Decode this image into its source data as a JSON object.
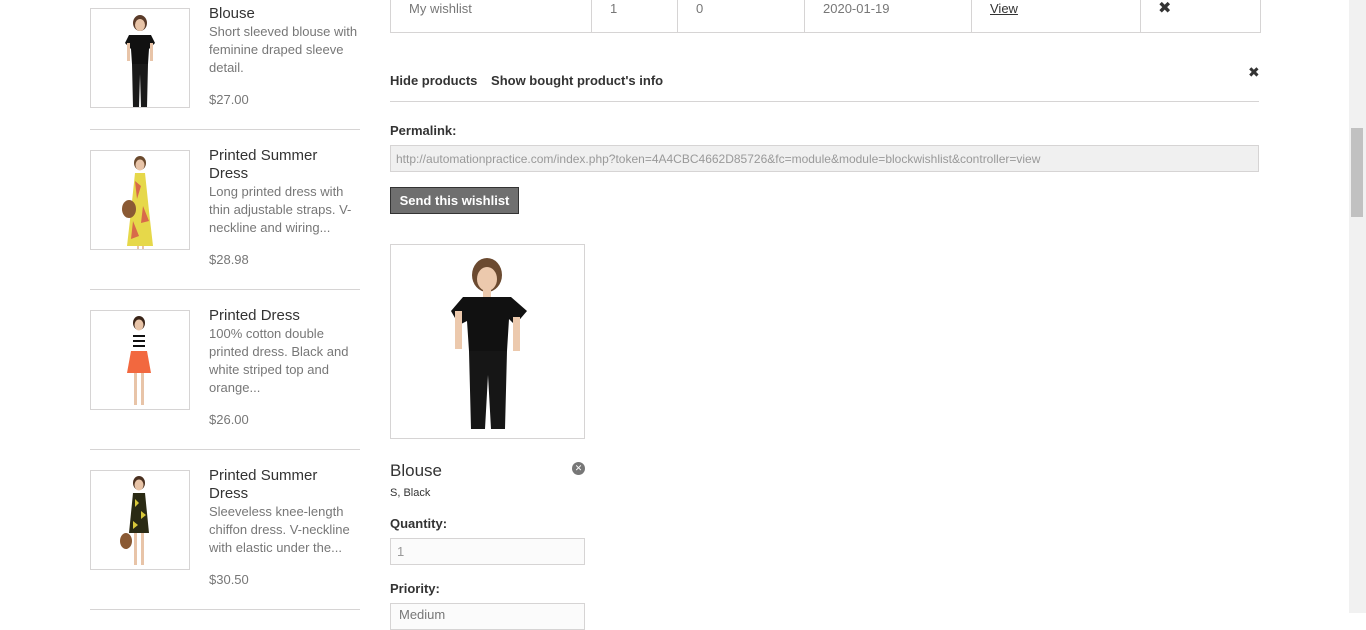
{
  "sidebar": {
    "products": [
      {
        "name": "Blouse",
        "description": "Short sleeved blouse with feminine draped sleeve detail.",
        "price": "$27.00"
      },
      {
        "name": "Printed Summer Dress",
        "description": "Long printed dress with thin adjustable straps. V-neckline and wiring...",
        "price": "$28.98"
      },
      {
        "name": "Printed Dress",
        "description": "100% cotton double printed dress. Black and white striped top and orange...",
        "price": "$26.00"
      },
      {
        "name": "Printed Summer Dress",
        "description": "Sleeveless knee-length chiffon dress. V-neckline with elastic under the...",
        "price": "$30.50"
      }
    ]
  },
  "wishlist_table": {
    "row": {
      "name": "My wishlist",
      "quantity": "1",
      "viewed": "0",
      "created": "2020-01-19",
      "view_link": "View",
      "delete_icon": "close-icon"
    }
  },
  "actions": {
    "hide_products": "Hide products",
    "show_bought": "Show bought product's info",
    "close_icon": "close-icon"
  },
  "permalink": {
    "label": "Permalink:",
    "value": "http://automationpractice.com/index.php?token=4A4CBC4662D85726&fc=module&module=blockwishlist&controller=view"
  },
  "send_button": "Send this wishlist",
  "wishlist_product": {
    "name": "Blouse",
    "attributes": "S, Black",
    "quantity_label": "Quantity:",
    "quantity_value": "1",
    "priority_label": "Priority:",
    "priority_value": "Medium",
    "remove_icon": "remove-circle-icon"
  },
  "colors": {
    "button_bg": "#6f6f6f",
    "border": "#d6d4d4",
    "text_muted": "#777777"
  }
}
